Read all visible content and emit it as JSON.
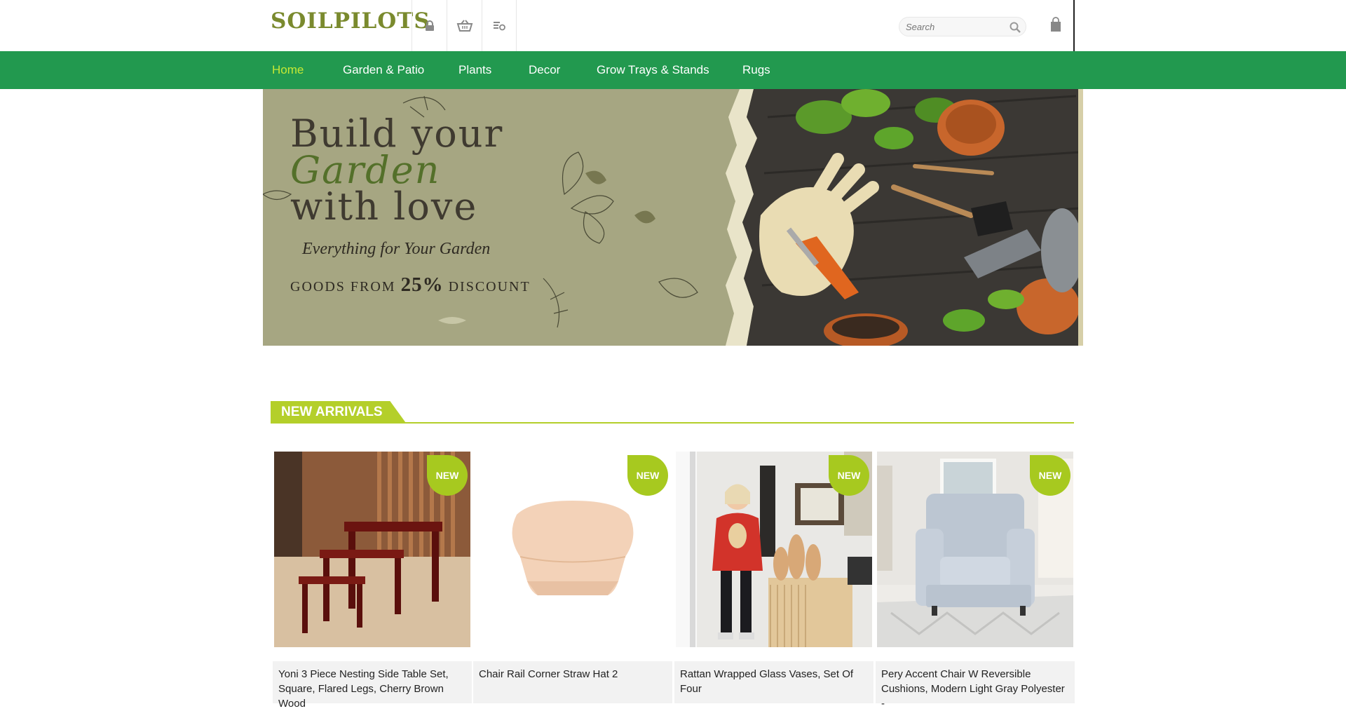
{
  "header": {
    "logo_text": "SOILPILOTS",
    "icons": [
      "lock-icon",
      "basket-icon",
      "list-icon"
    ],
    "search": {
      "placeholder": "Search"
    },
    "cart_icon": "bag-icon"
  },
  "nav": {
    "items": [
      {
        "label": "Home",
        "active": true
      },
      {
        "label": "Garden & Patio",
        "active": false
      },
      {
        "label": "Plants",
        "active": false
      },
      {
        "label": "Decor",
        "active": false
      },
      {
        "label": "Grow Trays & Stands",
        "active": false
      },
      {
        "label": "Rugs",
        "active": false
      }
    ]
  },
  "hero": {
    "title_line1": "Build your",
    "title_line2": "Garden",
    "title_line3": "with love",
    "subtitle": "Everything for Your Garden",
    "discount_prefix": "GOODS FROM",
    "discount_value": "25%",
    "discount_suffix": "DISCOUNT"
  },
  "section": {
    "title": "NEW ARRIVALS"
  },
  "products": [
    {
      "badge": "NEW",
      "title": "Yoni 3 Piece Nesting Side Table Set, Square, Flared Legs, Cherry Brown Wood"
    },
    {
      "badge": "NEW",
      "title": "Chair Rail Corner Straw Hat 2"
    },
    {
      "badge": "NEW",
      "title": "Rattan Wrapped Glass Vases, Set Of Four"
    },
    {
      "badge": "NEW",
      "title": "Pery Accent Chair W Reversible Cushions, Modern Light Gray Polyester -"
    }
  ],
  "colors": {
    "nav_bg": "#22994f",
    "nav_active": "#c5e835",
    "accent": "#b4cf2a",
    "badge": "#a7c91f",
    "logo": "#7a8a2e"
  }
}
